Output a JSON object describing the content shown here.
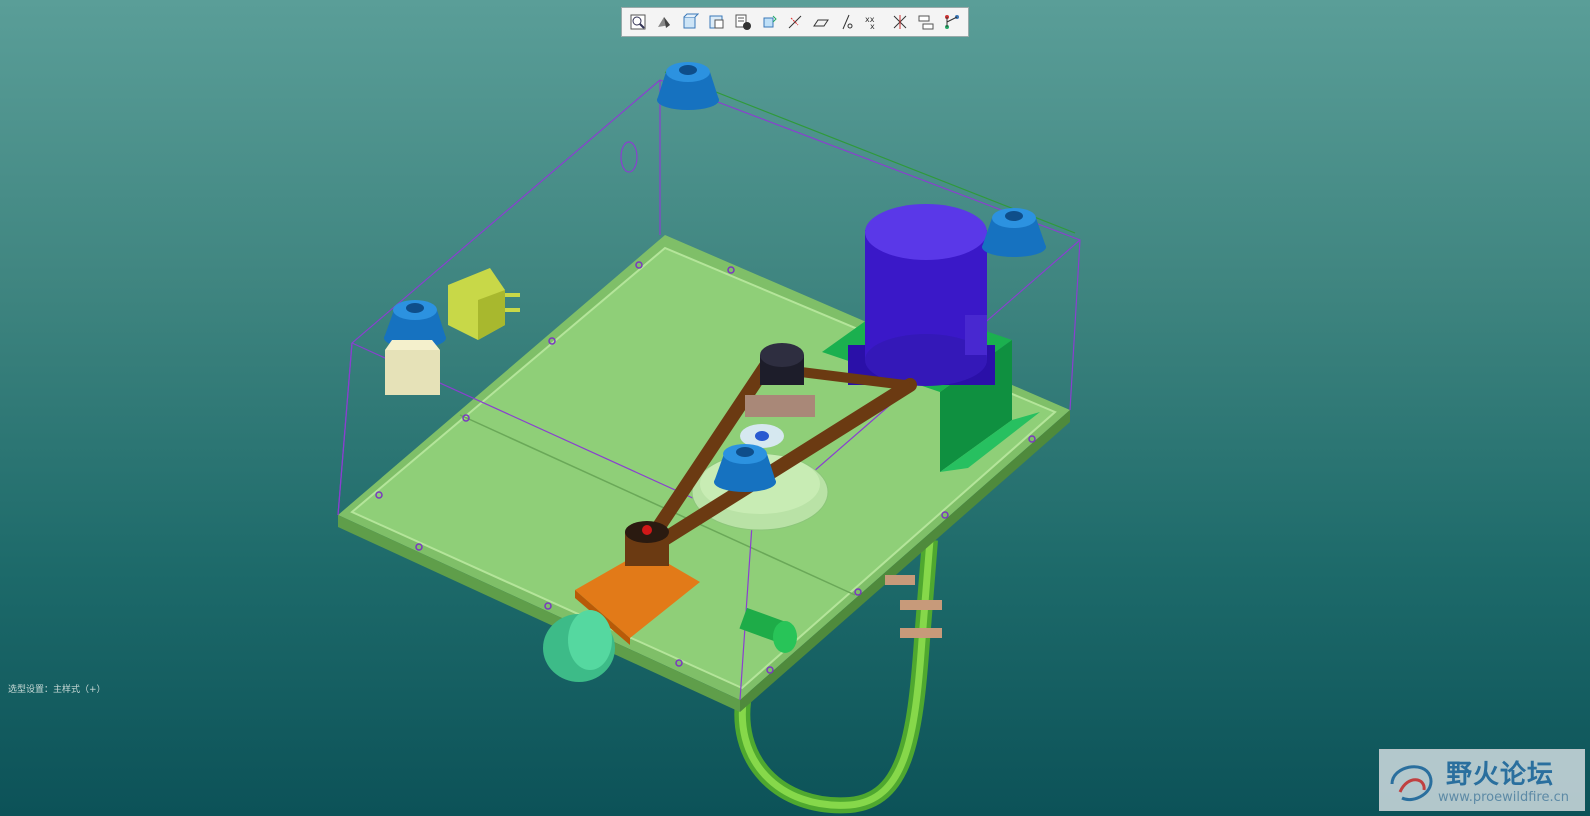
{
  "toolbar": {
    "buttons": [
      {
        "icon": "zoom-window-icon"
      },
      {
        "icon": "shading-icon"
      },
      {
        "icon": "saved-view-icon"
      },
      {
        "icon": "view-manager-icon"
      },
      {
        "icon": "layers-icon"
      },
      {
        "icon": "spin-center-icon"
      },
      {
        "icon": "datum-planes-icon"
      },
      {
        "icon": "datum-axes-icon"
      },
      {
        "icon": "datum-points-icon"
      },
      {
        "icon": "coordinate-systems-icon"
      },
      {
        "icon": "annotations-icon"
      },
      {
        "icon": "model-tree-icon"
      },
      {
        "icon": "connect-icon"
      }
    ]
  },
  "viewport": {
    "model_description": "3D assembly of motor box with belt drive"
  },
  "status": {
    "message": "选型设置：主样式（+）"
  },
  "watermark": {
    "title": "野火论坛",
    "url": "www.proewildfire.cn"
  },
  "colors": {
    "background_top": "#5a9e98",
    "background_bottom": "#0c5258",
    "base_plate": "#8fcf78",
    "motor": "#3a18c8",
    "feet": "#1672c0",
    "bracket": "#0fa048",
    "belt": "#6b3a12",
    "wireframe": "#8a3fd0"
  }
}
